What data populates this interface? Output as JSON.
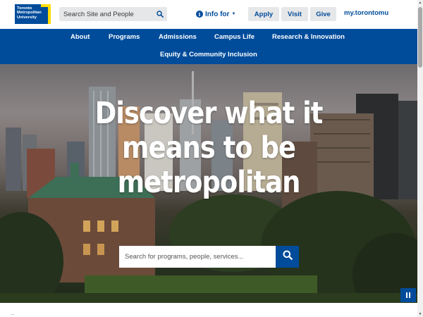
{
  "logo": {
    "lines": [
      "Toronto",
      "Metropolitan",
      "University"
    ],
    "colors": {
      "blue": "#004c9b",
      "yellow": "#ffdc00"
    }
  },
  "site_search": {
    "placeholder": "Search Site and People",
    "icon": "search-icon"
  },
  "utility": {
    "info_for": "Info for",
    "apply": "Apply",
    "visit": "Visit",
    "give": "Give",
    "my_link": "my.torontomu"
  },
  "nav": {
    "items": [
      {
        "label": "About"
      },
      {
        "label": "Programs"
      },
      {
        "label": "Admissions"
      },
      {
        "label": "Campus Life"
      },
      {
        "label": "Research & Innovation"
      },
      {
        "label": "Equity & Community Inclusion"
      }
    ]
  },
  "hero": {
    "title_lines": [
      "Discover what it",
      "means to be",
      "metropolitan"
    ],
    "search_placeholder": "Search for programs, people, services...",
    "search_icon": "search-icon",
    "pause_icon": "pause-icon"
  },
  "theme": {
    "brand_blue": "#004c9b",
    "button_gray": "#e6e7e8"
  }
}
